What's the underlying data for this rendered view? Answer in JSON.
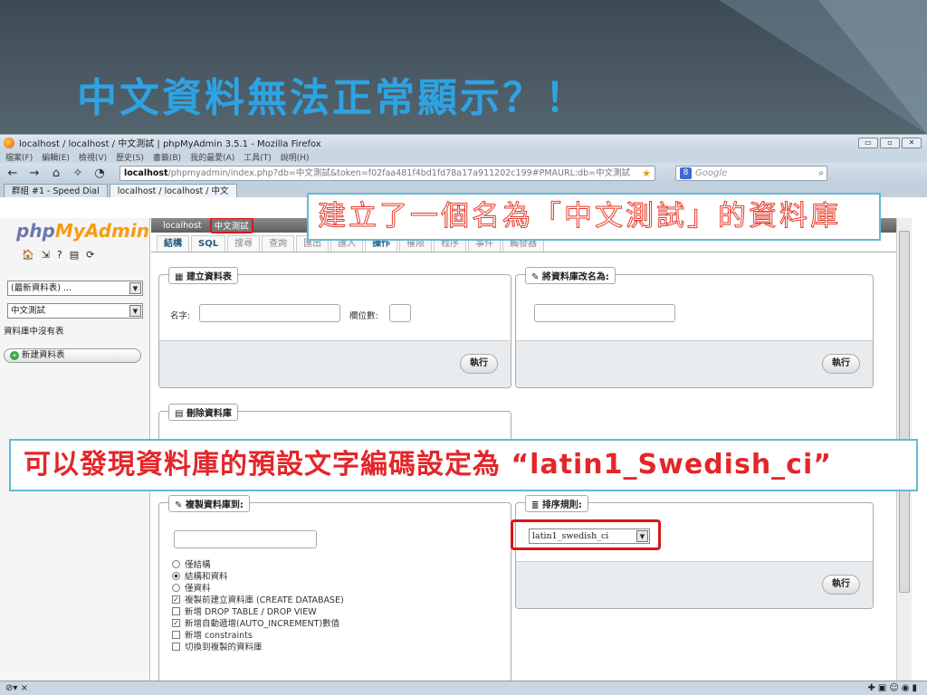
{
  "slide": {
    "title": "中文資料無法正常顯示？！"
  },
  "browser": {
    "window_title": "localhost / localhost / 中文測試 | phpMyAdmin 3.5.1 - Mozilla Firefox",
    "menu": [
      "檔案(F)",
      "編輯(E)",
      "檢視(V)",
      "歷史(S)",
      "書籤(B)",
      "我的最愛(A)",
      "工具(T)",
      "說明(H)"
    ],
    "url_host": "localhost",
    "url_rest": "/phpmyadmin/index.php?db=中文測試&token=f02faa481f4bd1fd78a17a911202c199#PMAURL:db=中文測試",
    "search_placeholder": "Google",
    "tabs": [
      "群組 #1 - Speed Dial",
      "localhost / localhost / 中文"
    ],
    "window_buttons": [
      "▭",
      "▫",
      "✕"
    ]
  },
  "pma": {
    "logo_php": "php",
    "logo_my": "MyAdmin",
    "recent_select": "(最新資料表) ...",
    "db_select": "中文測試",
    "no_tables_text": "資料庫中沒有表",
    "new_table_button": "新建資料表",
    "breadcrumb": [
      "localhost",
      "中文測試"
    ],
    "tabs": [
      "結構",
      "SQL",
      "搜尋",
      "查詢",
      "匯出",
      "匯入",
      "操作",
      "權限",
      "程序",
      "事件",
      "觸發器"
    ],
    "create_table": {
      "legend": "建立資料表",
      "name_label": "名字:",
      "columns_label": "欄位數:",
      "go": "執行"
    },
    "rename_db": {
      "legend": "將資料庫改名為:",
      "go": "執行"
    },
    "drop_db": {
      "legend": "刪除資料庫"
    },
    "copy_db": {
      "legend": "複製資料庫到:",
      "options": [
        {
          "type": "radio",
          "checked": false,
          "label": "僅結構"
        },
        {
          "type": "radio",
          "checked": true,
          "label": "結構和資料"
        },
        {
          "type": "radio",
          "checked": false,
          "label": "僅資料"
        },
        {
          "type": "checkbox",
          "checked": true,
          "label": "複製前建立資料庫 (CREATE DATABASE)"
        },
        {
          "type": "checkbox",
          "checked": false,
          "label": "新增 DROP TABLE / DROP VIEW"
        },
        {
          "type": "checkbox",
          "checked": true,
          "label": "新增自動遞增(AUTO_INCREMENT)數值"
        },
        {
          "type": "checkbox",
          "checked": false,
          "label": "新增 constraints"
        },
        {
          "type": "checkbox",
          "checked": false,
          "label": "切換到複製的資料庫"
        }
      ]
    },
    "collation": {
      "legend": "排序規則:",
      "value": "latin1_swedish_ci",
      "go": "執行"
    }
  },
  "annotations": {
    "callout_top": "建立了一個名為「中文測試」的資料庫",
    "callout_bottom": "可以發現資料庫的預設文字編碼設定為 “latin1_Swedish_ci”",
    "highlight_color": "#d51818",
    "callout_border": "#63b9d9"
  },
  "theme": {
    "title_color": "#2ea3e3",
    "callout_text": "#e3262a"
  }
}
